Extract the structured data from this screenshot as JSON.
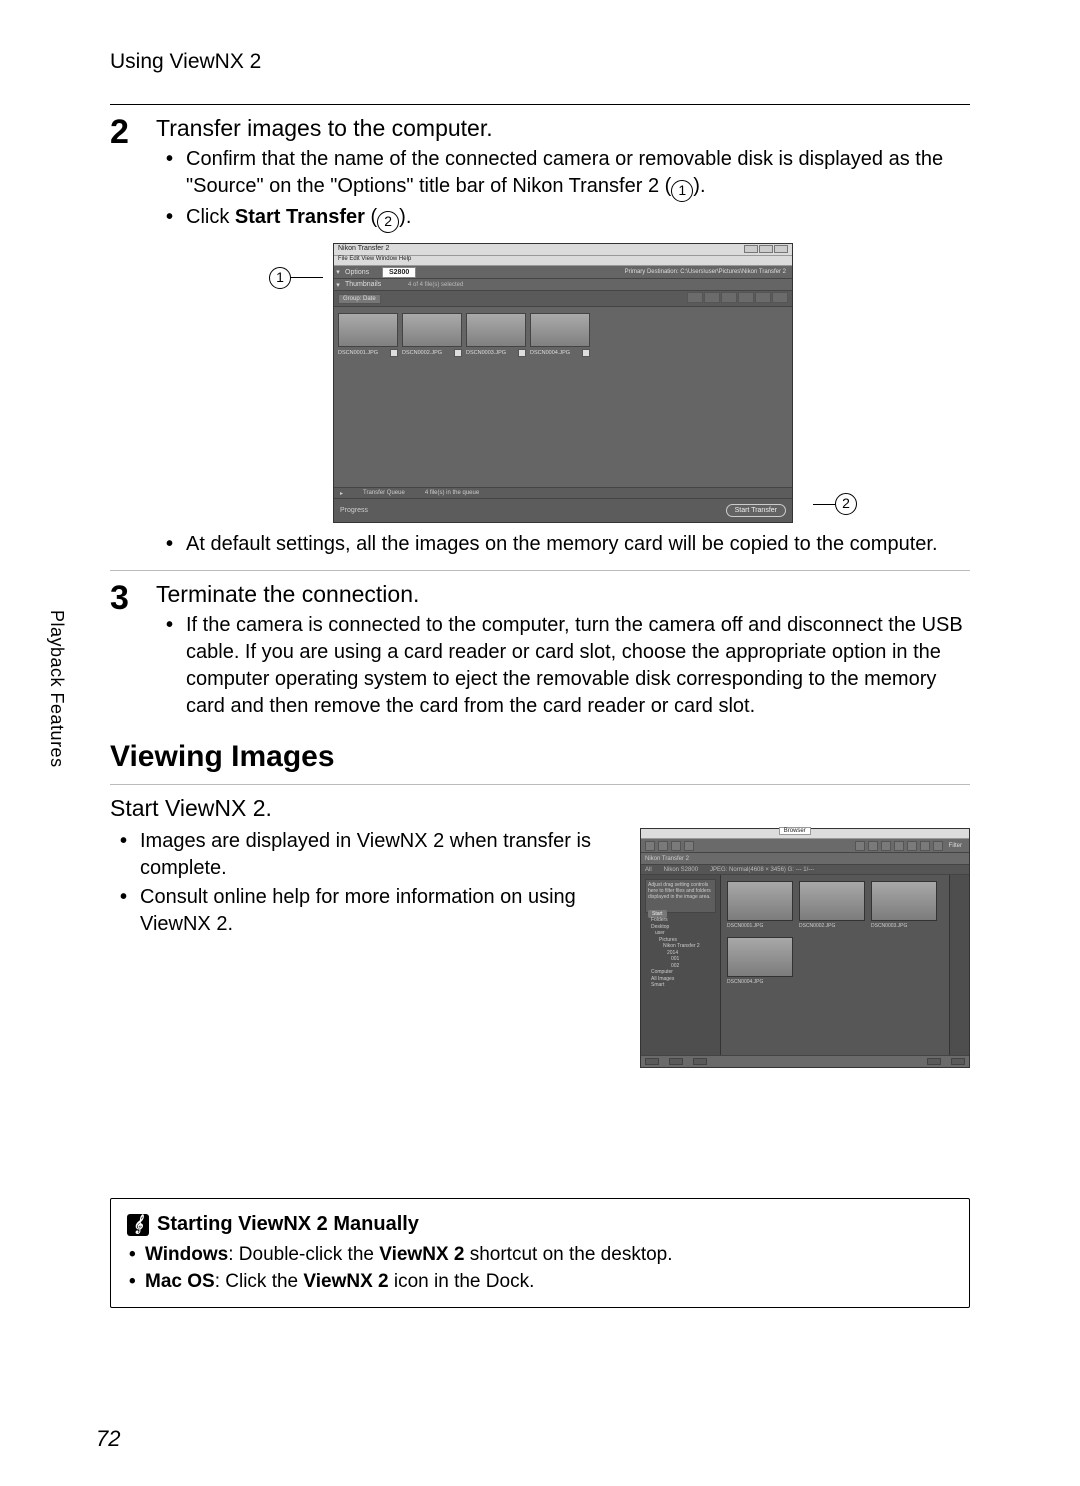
{
  "header": {
    "title": "Using ViewNX 2"
  },
  "sideTab": "Playback Features",
  "pageNumber": "72",
  "step2": {
    "number": "2",
    "heading": "Transfer images to the computer.",
    "bullet1_pre": "Confirm that the name of the connected camera or removable disk is displayed as the \"Source\" on the \"Options\" title bar of Nikon Transfer 2 (",
    "bullet1_c": "1",
    "bullet1_post": ").",
    "bullet2_pre": "Click ",
    "bullet2_bold": "Start Transfer",
    "bullet2_mid": " (",
    "bullet2_c": "2",
    "bullet2_post": ").",
    "bullet3": "At default settings, all the images on the memory card will be copied to the computer."
  },
  "nt2": {
    "title": "Nikon Transfer 2",
    "menu": "File  Edit  View  Window  Help",
    "options_label": "Options",
    "source_value": "S2800",
    "options_right": "Primary Destination: C:\\Users\\user\\Pictures\\Nikon Transfer 2",
    "thumbnails_label": "Thumbnails",
    "thumbnails_info": "4 of 4 file(s) selected",
    "sort_label": "Group: Date",
    "thumbs": [
      {
        "name": "DSCN0001.JPG"
      },
      {
        "name": "DSCN0002.JPG"
      },
      {
        "name": "DSCN0003.JPG"
      },
      {
        "name": "DSCN0004.JPG"
      }
    ],
    "status_left": "Transfer Queue",
    "status_mid": "4 file(s) in the queue",
    "bottom_label": "Progress",
    "start_btn": "Start Transfer",
    "callout1": "1",
    "callout2": "2"
  },
  "step3": {
    "number": "3",
    "heading": "Terminate the connection.",
    "bullet1": "If the camera is connected to the computer, turn the camera off and disconnect the USB cable. If you are using a card reader or card slot, choose the appropriate option in the computer operating system to eject the removable disk corresponding to the memory card and then remove the card from the card reader or card slot."
  },
  "section": {
    "title": "Viewing Images"
  },
  "start": {
    "heading": "Start ViewNX 2.",
    "bullet1": "Images are displayed in ViewNX 2 when transfer is complete.",
    "bullet2": "Consult online help for more information on using ViewNX 2."
  },
  "vnx2": {
    "workspace": "Browser",
    "filter": "Filter",
    "breadcrumb": "Nikon Transfer 2",
    "row3a": "All",
    "row3b": "Nikon S2800",
    "row3c": "JPEG: Normal(4608 × 3456)  G: ---  1/---",
    "thumbs": [
      {
        "name": "DSCN0001.JPG"
      },
      {
        "name": "DSCN0002.JPG"
      },
      {
        "name": "DSCN0003.JPG"
      }
    ],
    "thumbs_row2": [
      {
        "name": "DSCN0004.JPG"
      }
    ],
    "panel_text": "Adjust drag setting controls here to filter files and folders displayed in the image area.",
    "panel_btn": "Start",
    "tree": [
      "Folders",
      "Desktop",
      "user",
      "Pictures",
      "Nikon Transfer 2",
      "2014",
      "001",
      "002",
      "Computer",
      "All Images",
      "Smart"
    ]
  },
  "note": {
    "title": "Starting ViewNX 2 Manually",
    "b1_bold1": "Windows",
    "b1_mid": ": Double-click the ",
    "b1_bold2": "ViewNX 2",
    "b1_post": " shortcut on the desktop.",
    "b2_bold1": "Mac OS",
    "b2_mid": ": Click the ",
    "b2_bold2": "ViewNX 2",
    "b2_post": " icon in the Dock."
  }
}
